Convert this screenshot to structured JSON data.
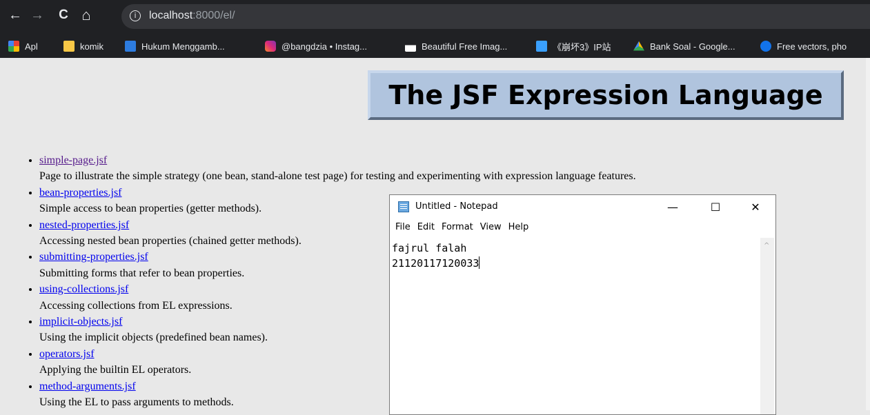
{
  "browser": {
    "url_host": "localhost",
    "url_rest": ":8000/el/",
    "nav": {
      "back": "←",
      "forward": "→",
      "reload": "C",
      "home": "⌂",
      "info": "i"
    }
  },
  "bookmarks": [
    {
      "label": "Apl",
      "icon": "apps-grid-icon",
      "color": "#f4b400"
    },
    {
      "label": "komik",
      "icon": "folder-icon",
      "color": "#f9c846"
    },
    {
      "label": "Hukum Menggamb...",
      "icon": "sites-icon",
      "color": "#2d7ce0"
    },
    {
      "label": "@bangdzia • Instag...",
      "icon": "instagram-icon",
      "color": "#e1306c"
    },
    {
      "label": "Beautiful Free Imag...",
      "icon": "unsplash-icon",
      "color": "#ffffff"
    },
    {
      "label": "《崩坏3》IP站",
      "icon": "mihoyo-icon",
      "color": "#3aa0ff"
    },
    {
      "label": "Bank Soal - Google...",
      "icon": "google-drive-icon",
      "color": "#1fa463"
    },
    {
      "label": "Free vectors, pho",
      "icon": "freepik-icon",
      "color": "#1273eb"
    }
  ],
  "page": {
    "title": "The JSF Expression Language",
    "items": [
      {
        "link": "simple-page.jsf",
        "desc": "Page to illustrate the simple strategy (one bean, stand-alone test page) for testing and experimenting with expression language features.",
        "visited": true
      },
      {
        "link": "bean-properties.jsf",
        "desc": "Simple access to bean properties (getter methods).",
        "visited": false
      },
      {
        "link": "nested-properties.jsf",
        "desc": "Accessing nested bean properties (chained getter methods).",
        "visited": false
      },
      {
        "link": "submitting-properties.jsf",
        "desc": "Submitting forms that refer to bean properties.",
        "visited": false
      },
      {
        "link": "using-collections.jsf",
        "desc": "Accessing collections from EL expressions.",
        "visited": false
      },
      {
        "link": "implicit-objects.jsf",
        "desc": "Using the implicit objects (predefined bean names).",
        "visited": false
      },
      {
        "link": "operators.jsf",
        "desc": "Applying the builtin EL operators.",
        "visited": false
      },
      {
        "link": "method-arguments.jsf",
        "desc": "Using the EL to pass arguments to methods.",
        "visited": false
      }
    ]
  },
  "notepad": {
    "title": "Untitled - Notepad",
    "controls": {
      "minimize": "—",
      "maximize": "☐",
      "close": "✕"
    },
    "menu": [
      "File",
      "Edit",
      "Format",
      "View",
      "Help"
    ],
    "lines": [
      "fajrul falah",
      "21120117120033"
    ]
  }
}
